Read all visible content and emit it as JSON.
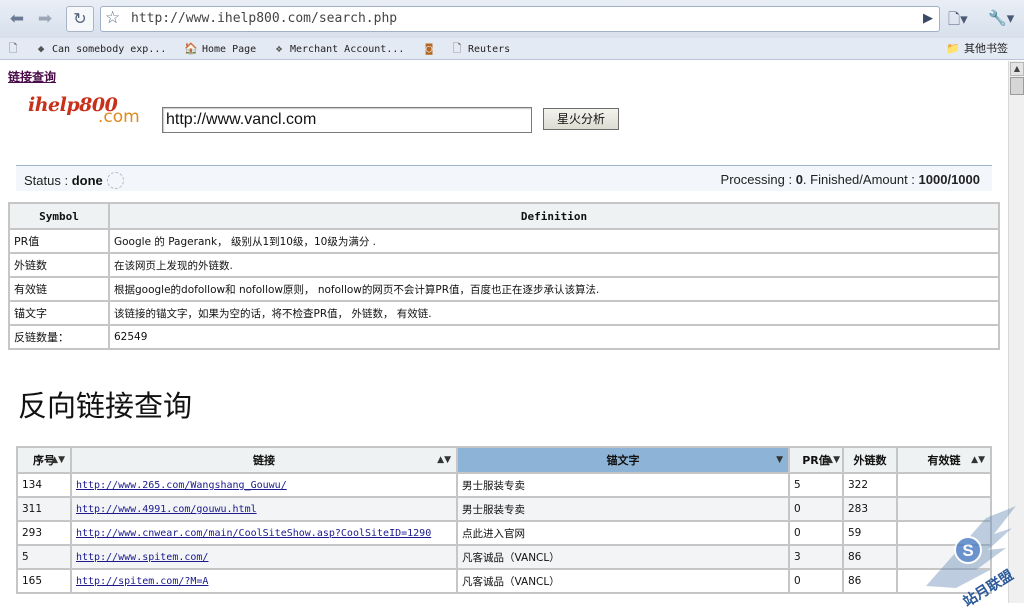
{
  "browser": {
    "url": "http://www.ihelp800.com/search.php",
    "bookmarks": [
      {
        "label": "",
        "icon": "page-icon"
      },
      {
        "label": "Can somebody exp...",
        "icon": "code-icon"
      },
      {
        "label": "Home Page",
        "icon": "home-icon"
      },
      {
        "label": "Merchant Account...",
        "icon": "merchant-icon"
      },
      {
        "label": "",
        "icon": "feed-icon"
      },
      {
        "label": "Reuters",
        "icon": "page-icon"
      }
    ],
    "other_bookmarks": "其他书签"
  },
  "page": {
    "top_link": "链接查询",
    "logo": {
      "part1": "ihelp800",
      "part2": ".com"
    },
    "search": {
      "value": "http://www.vancl.com",
      "button": "星火分析"
    },
    "status": {
      "label": "Status : ",
      "value": "done",
      "processing_label": "Processing : ",
      "processing_value": "0",
      "finished_label": ". Finished/Amount : ",
      "finished_value": "1000/1000"
    },
    "symbol_table": {
      "headers": [
        "Symbol",
        "Definition"
      ],
      "rows": [
        {
          "symbol": "PR值",
          "definition": "Google 的 Pagerank， 级别从1到10级，10级为满分 ."
        },
        {
          "symbol": "外链数",
          "definition": "在该网页上发现的外链数."
        },
        {
          "symbol": "有效链",
          "definition": "根据google的dofollow和 nofollow原则， nofollow的网页不会计算PR值，百度也正在逐步承认该算法."
        },
        {
          "symbol": "锚文字",
          "definition": "该链接的锚文字，如果为空的话，将不检查PR值， 外链数， 有效链."
        },
        {
          "symbol": "反链数量：",
          "definition": "62549"
        }
      ]
    },
    "section_title": "反向链接查询",
    "backlinks": {
      "headers": [
        "序号",
        "链接",
        "锚文字",
        "PR值",
        "外链数",
        "有效链"
      ],
      "rows": [
        {
          "id": "134",
          "link": "http://www.265.com/Wangshang_Gouwu/",
          "anchor": "男士服装专卖",
          "pr": "5",
          "outlinks": "322",
          "valid": ""
        },
        {
          "id": "311",
          "link": "http://www.4991.com/gouwu.html",
          "anchor": "男士服装专卖",
          "pr": "0",
          "outlinks": "283",
          "valid": ""
        },
        {
          "id": "293",
          "link": "http://www.cnwear.com/main/CoolSiteShow.asp?CoolSiteID=1290",
          "anchor": "点此进入官网",
          "pr": "0",
          "outlinks": "59",
          "valid": ""
        },
        {
          "id": "5",
          "link": "http://www.spitem.com/",
          "anchor": "凡客诚品（VANCL）",
          "pr": "3",
          "outlinks": "86",
          "valid": ""
        },
        {
          "id": "165",
          "link": "http://spitem.com/?M=A",
          "anchor": "凡客诚品（VANCL）",
          "pr": "0",
          "outlinks": "86",
          "valid": ""
        }
      ]
    }
  },
  "watermark": {
    "text": "站月联盟"
  },
  "colors": {
    "sorted_header": "#8db3d6",
    "link": "#1a1a8c",
    "visited": "#4a0d4a"
  }
}
